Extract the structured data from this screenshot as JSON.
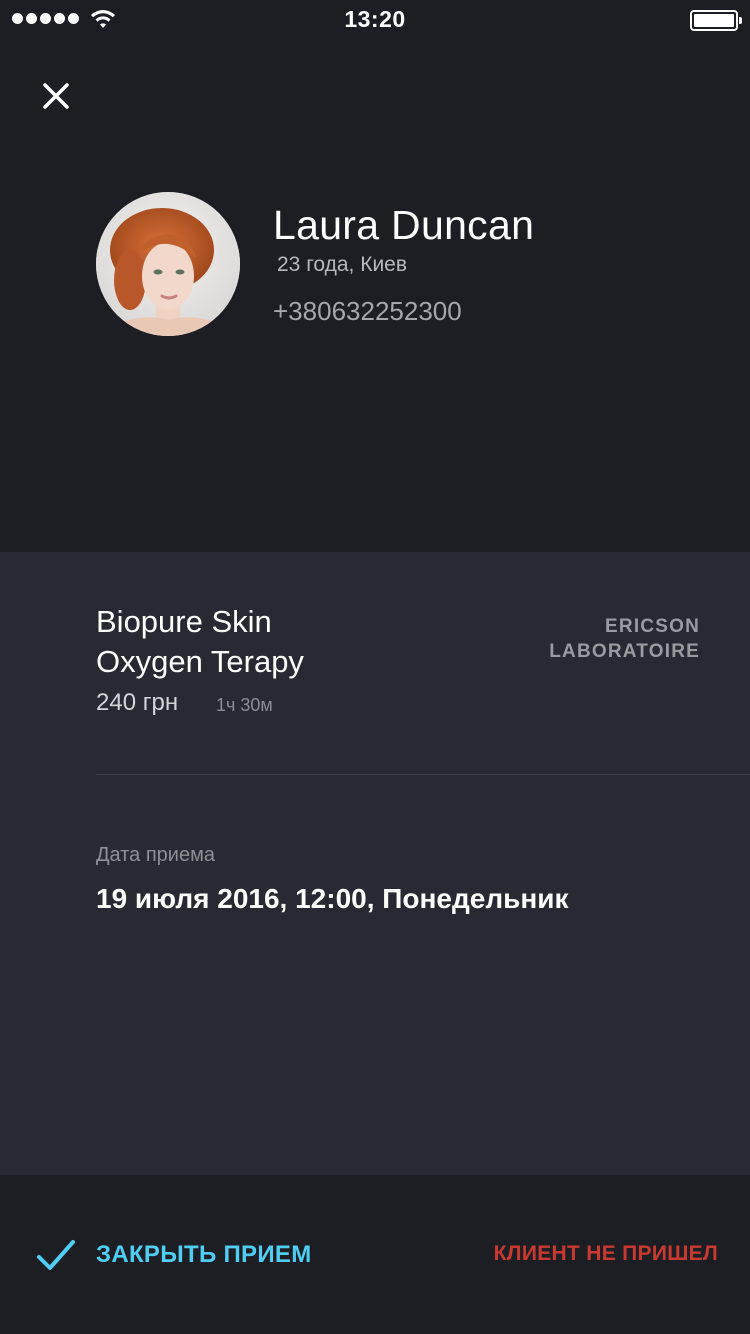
{
  "status_bar": {
    "time": "13:20",
    "signal_icon": "signal-dots-icon",
    "wifi_icon": "wifi-icon",
    "battery_icon": "battery-icon"
  },
  "header": {
    "close_icon": "close-icon"
  },
  "client": {
    "name": "Laura Duncan",
    "age_city": "23 года, Киев",
    "phone": "+380632252300"
  },
  "service": {
    "name_line1": "Biopure Skin",
    "name_line2": "Oxygen Terapy",
    "price": "240 грн",
    "duration": "1ч 30м",
    "brand_line1": "ERICSON",
    "brand_line2": "LABORATOIRE"
  },
  "appointment": {
    "date_label": "Дата приема",
    "date_value": "19 июля 2016, 12:00, Понедельник"
  },
  "actions": {
    "close_label": "ЗАКРЫТЬ ПРИЕМ",
    "no_show_label": "КЛИЕНТ НЕ ПРИШЕЛ"
  },
  "colors": {
    "background": "#1d1e24",
    "panel": "#282932",
    "accent": "#4fcdf2",
    "danger": "#c9392f"
  }
}
